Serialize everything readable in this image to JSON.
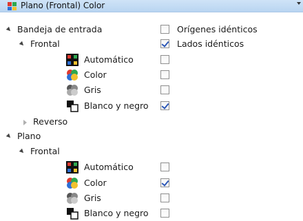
{
  "dropdown": {
    "selected": "Plano (Frontal) Color"
  },
  "tree": {
    "bandeja": {
      "label": "Bandeja de entrada",
      "frontal": {
        "label": "Frontal",
        "items": [
          {
            "label": "Automático",
            "checked": false
          },
          {
            "label": "Color",
            "checked": false
          },
          {
            "label": "Gris",
            "checked": false
          },
          {
            "label": "Blanco y negro",
            "checked": true
          }
        ]
      },
      "reverso": {
        "label": "Reverso"
      }
    },
    "plano": {
      "label": "Plano",
      "frontal": {
        "label": "Frontal",
        "items": [
          {
            "label": "Automático",
            "checked": false
          },
          {
            "label": "Color",
            "checked": true
          },
          {
            "label": "Gris",
            "checked": false
          },
          {
            "label": "Blanco y negro",
            "checked": false
          }
        ]
      }
    }
  },
  "options": {
    "origenes": {
      "label": "Orígenes idénticos",
      "checked": false
    },
    "lados": {
      "label": "Lados idénticos",
      "checked": true
    }
  }
}
